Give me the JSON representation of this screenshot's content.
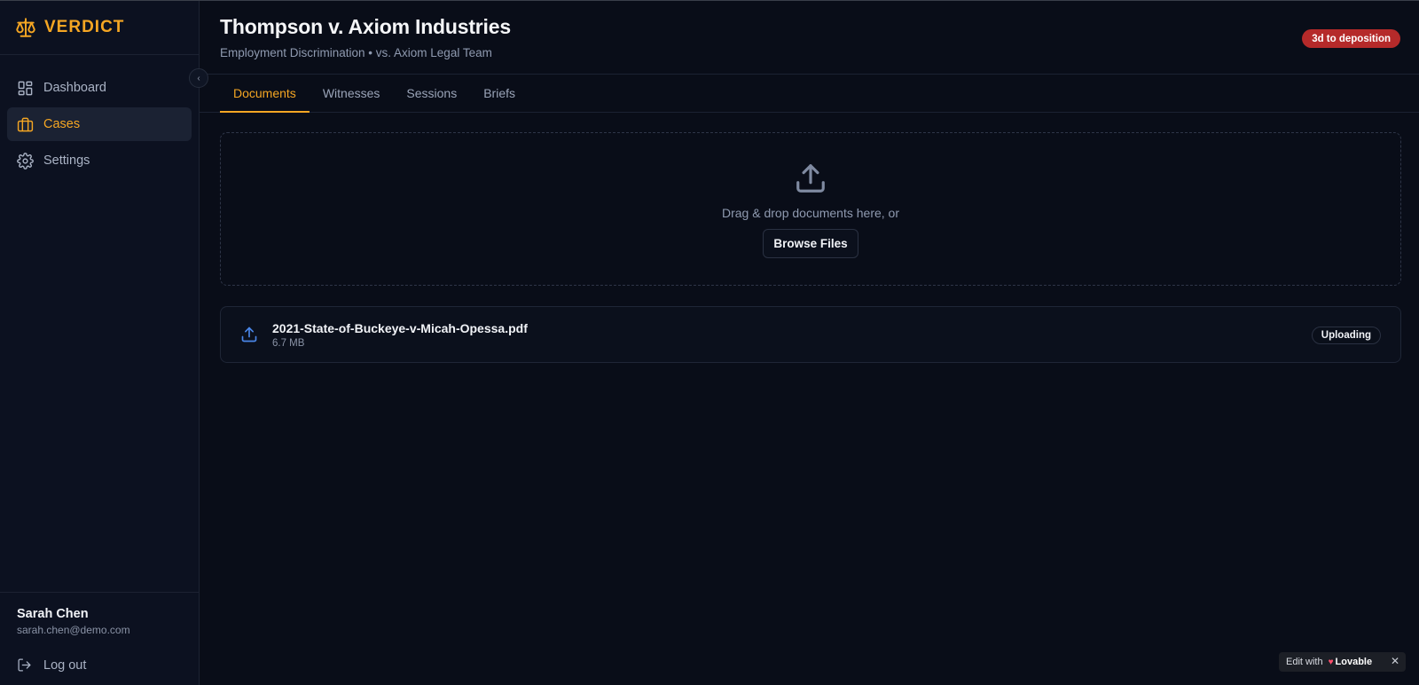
{
  "app": {
    "name": "VERDICT",
    "accent": "#f5a623"
  },
  "sidebar": {
    "items": [
      {
        "label": "Dashboard",
        "icon": "dashboard-icon",
        "active": false
      },
      {
        "label": "Cases",
        "icon": "briefcase-icon",
        "active": true
      },
      {
        "label": "Settings",
        "icon": "gear-icon",
        "active": false
      }
    ],
    "user": {
      "name": "Sarah Chen",
      "email": "sarah.chen@demo.com"
    },
    "logout_label": "Log out"
  },
  "case": {
    "title": "Thompson v. Axiom Industries",
    "subtitle": "Employment Discrimination • vs. Axiom Legal Team",
    "deadline_badge": "3d to deposition",
    "deadline_color": "#b52a2a"
  },
  "tabs": [
    {
      "label": "Documents",
      "active": true
    },
    {
      "label": "Witnesses",
      "active": false
    },
    {
      "label": "Sessions",
      "active": false
    },
    {
      "label": "Briefs",
      "active": false
    }
  ],
  "dropzone": {
    "text": "Drag & drop documents here, or",
    "browse_label": "Browse Files"
  },
  "files": [
    {
      "name": "2021-State-of-Buckeye-v-Micah-Opessa.pdf",
      "size": "6.7 MB",
      "status": "Uploading"
    }
  ],
  "lovable_badge": {
    "edit_with": "Edit with",
    "brand": "Lovable",
    "close": "✕"
  }
}
